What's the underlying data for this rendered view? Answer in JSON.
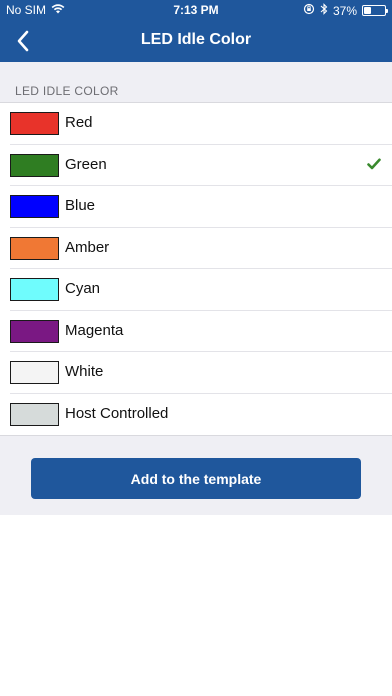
{
  "status_bar": {
    "carrier": "No SIM",
    "time": "7:13 PM",
    "battery_percent": "37%",
    "battery_level": 0.37
  },
  "nav": {
    "title": "LED Idle Color",
    "back_icon": "chevron-left-icon"
  },
  "section": {
    "header": "LED IDLE COLOR"
  },
  "options": [
    {
      "label": "Red",
      "color": "#e8332a",
      "selected": false
    },
    {
      "label": "Green",
      "color": "#2f7d22",
      "selected": true
    },
    {
      "label": "Blue",
      "color": "#0000ff",
      "selected": false
    },
    {
      "label": "Amber",
      "color": "#f07834",
      "selected": false
    },
    {
      "label": "Cyan",
      "color": "#6ffcfd",
      "selected": false
    },
    {
      "label": "Magenta",
      "color": "#7a1883",
      "selected": false
    },
    {
      "label": "White",
      "color": "#f4f4f4",
      "selected": false
    },
    {
      "label": "Host Controlled",
      "color": "#d6dbda",
      "selected": false
    }
  ],
  "colors": {
    "brand": "#1f579c",
    "check": "#3a8a2e",
    "background": "#efeff4"
  },
  "actions": {
    "add_label": "Add to the template"
  }
}
